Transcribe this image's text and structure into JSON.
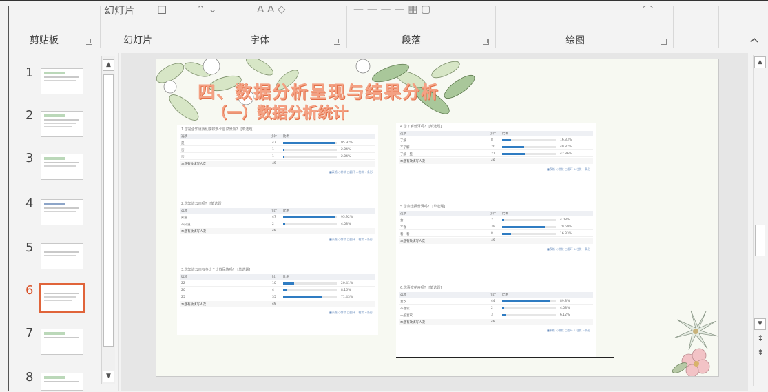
{
  "ribbon": {
    "top_cut": [
      "幻灯片",
      "□"
    ],
    "groups": [
      {
        "label": "剪贴板"
      },
      {
        "label": "幻灯片"
      },
      {
        "label": "字体"
      },
      {
        "label": "段落"
      },
      {
        "label": "绘图"
      }
    ],
    "collapse_icon": "chevron-up-icon"
  },
  "thumbnails": [
    {
      "number": "1"
    },
    {
      "number": "2"
    },
    {
      "number": "3"
    },
    {
      "number": "4"
    },
    {
      "number": "5"
    },
    {
      "number": "6",
      "selected": true
    },
    {
      "number": "7"
    },
    {
      "number": "8"
    }
  ],
  "slide": {
    "title": "四、数据分析呈现与结果分析",
    "subtitle": "（一）数据分析统计",
    "legend": "■表格 ○饼状 □圆环 ⊥柱状 ⌐条形",
    "left_questions": [
      {
        "title": "1.您是否知道我们学校多个自然景观？ [单选题]",
        "header": [
          "选项",
          "小计",
          "比例"
        ],
        "rows": [
          {
            "option": "是",
            "count": "47",
            "pct": "95.92%",
            "ratio": 0.9592
          },
          {
            "option": "否",
            "count": "1",
            "pct": "2.04%",
            "ratio": 0.0204
          },
          {
            "option": "否",
            "count": "1",
            "pct": "2.04%",
            "ratio": 0.0204
          }
        ],
        "total_label": "本题有效填写人次",
        "total": "49"
      },
      {
        "title": "2.您知道云南吗？ [单选题]",
        "header": [
          "选项",
          "小计",
          "比例"
        ],
        "rows": [
          {
            "option": "知道",
            "count": "47",
            "pct": "95.92%",
            "ratio": 0.9592
          },
          {
            "option": "不知道",
            "count": "2",
            "pct": "4.08%",
            "ratio": 0.0408
          }
        ],
        "total_label": "本题有效填写人次",
        "total": "49"
      },
      {
        "title": "3.您知道云南有多少个少数民族吗？ [单选题]",
        "header": [
          "选项",
          "小计",
          "比例"
        ],
        "rows": [
          {
            "option": "22",
            "count": "10",
            "pct": "20.41%",
            "ratio": 0.2041
          },
          {
            "option": "20",
            "count": "4",
            "pct": "8.16%",
            "ratio": 0.0816
          },
          {
            "option": "25",
            "count": "35",
            "pct": "71.43%",
            "ratio": 0.7143
          }
        ],
        "total_label": "本题有效填写人次",
        "total": "49"
      }
    ],
    "right_questions": [
      {
        "title": "4.您了解普洱吗？ [单选题]",
        "header": [
          "选项",
          "小计",
          "比例"
        ],
        "rows": [
          {
            "option": "了解",
            "count": "8",
            "pct": "16.33%",
            "ratio": 0.1633
          },
          {
            "option": "不了解",
            "count": "20",
            "pct": "40.82%",
            "ratio": 0.4082
          },
          {
            "option": "了解一些",
            "count": "21",
            "pct": "42.86%",
            "ratio": 0.4286
          }
        ],
        "total_label": "本题有效填写人次",
        "total": "49"
      },
      {
        "title": "5.您会选择普洱吗？ [单选题]",
        "header": [
          "选项",
          "小计",
          "比例"
        ],
        "rows": [
          {
            "option": "会",
            "count": "2",
            "pct": "4.08%",
            "ratio": 0.0408
          },
          {
            "option": "不会",
            "count": "39",
            "pct": "79.59%",
            "ratio": 0.7959
          },
          {
            "option": "看一看",
            "count": "8",
            "pct": "16.33%",
            "ratio": 0.1633
          }
        ],
        "total_label": "本题有效填写人次",
        "total": "49"
      },
      {
        "title": "6.您喜欢花卉吗？ [单选题]",
        "header": [
          "选项",
          "小计",
          "比例"
        ],
        "rows": [
          {
            "option": "喜欢",
            "count": "44",
            "pct": "89.8%",
            "ratio": 0.898
          },
          {
            "option": "不喜欢",
            "count": "2",
            "pct": "4.08%",
            "ratio": 0.0408
          },
          {
            "option": "一般喜欢",
            "count": "3",
            "pct": "6.12%",
            "ratio": 0.0612
          }
        ],
        "total_label": "本题有效填写人次",
        "total": "49"
      }
    ]
  }
}
